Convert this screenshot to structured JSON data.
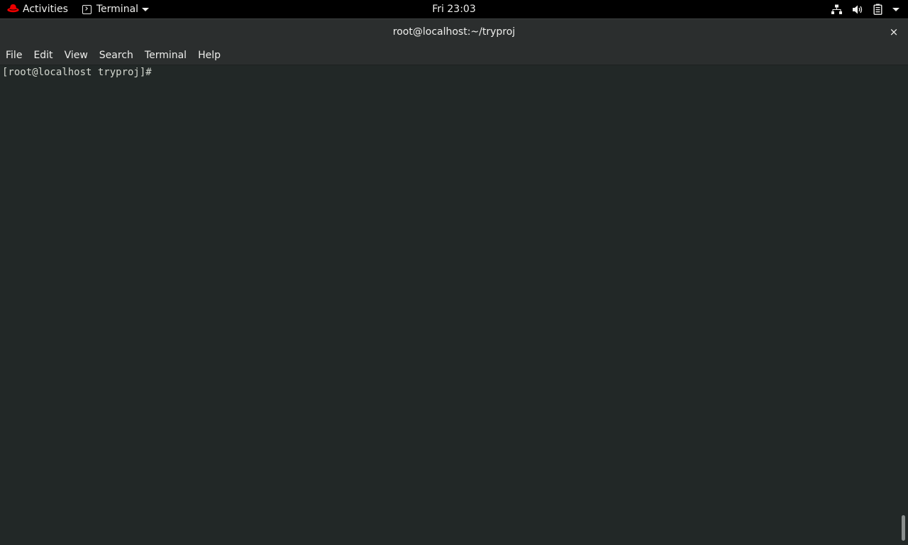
{
  "topbar": {
    "activities_label": "Activities",
    "app_menu_label": "Terminal",
    "clock": "Fri 23:03",
    "icons": [
      "network-icon",
      "volume-icon",
      "battery-icon",
      "system-menu-chevron-icon"
    ]
  },
  "window": {
    "title": "root@localhost:~/tryproj",
    "close_glyph": "×"
  },
  "menubar": {
    "items": [
      "File",
      "Edit",
      "View",
      "Search",
      "Terminal",
      "Help"
    ]
  },
  "terminal": {
    "prompt": "[root@localhost tryproj]#"
  },
  "colors": {
    "topbar_bg": "#000000",
    "titlebar_bg": "#2b2e2e",
    "terminal_bg": "#222827",
    "terminal_fg": "#d3d7cf",
    "redhat_red": "#ee0000"
  }
}
